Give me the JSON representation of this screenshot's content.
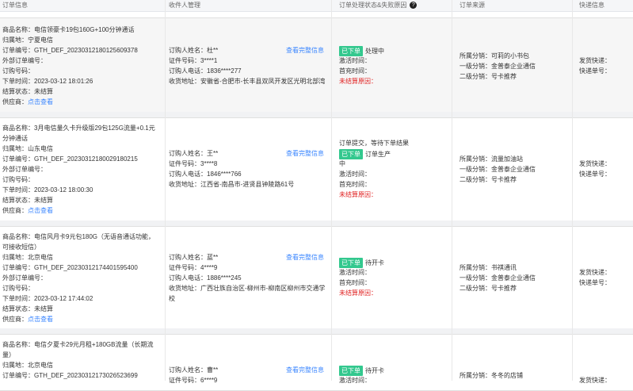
{
  "header": {
    "col_order": "订单信息",
    "col_receiver": "收件人管理",
    "col_status": "订单处理状态&失败原因",
    "col_source": "订单来源",
    "col_express": "快递信息"
  },
  "labels": {
    "product": "商品名称：",
    "region": "归属地：",
    "order_no": "订单编号：",
    "ext_no": "外部订单编号：",
    "order_code": "订购号码：",
    "order_time": "下单时间：",
    "settle": "结算状态：",
    "supplier": "供应商：",
    "view": "点击查看",
    "buyer": "订购人姓名：",
    "id_no": "证件号码：",
    "phone": "订购人电话：",
    "address": "收货地址：",
    "view_full": "查看完整信息",
    "activate": "激活时间：",
    "first_charge": "首充时间：",
    "not_settled_reason": "未结算原因：",
    "dist_owner": "所属分销：",
    "dist_l1": "一级分销：",
    "dist_l2": "二级分销：",
    "ship_express": "发货快递：",
    "express_no": "快递单号："
  },
  "orders": [
    {
      "product_1": "电信领豪卡19包160G+100分钟通话",
      "region": "宁夏电信",
      "order_no": "GTH_DEF_20230312180125609378",
      "time": "2023-03-12 18:01:26",
      "settle": "未结算",
      "buyer": "杜**",
      "id_no": "3****1",
      "phone": "1836****277",
      "address": "安徽省-合肥市-长丰县双凤开发区光明北部湾",
      "status_pre": "",
      "tag": "已下单",
      "status": "处理中",
      "dist_owner": "可莉的小书包",
      "dist_l1": "金普泰企业通信",
      "dist_l2": "号卡推荐"
    },
    {
      "product_1": "3月电信量久卡升级版29包125G流量+0.1元",
      "product_2": "分钟通话",
      "region": "山东电信",
      "order_no": "GTH_DEF_20230312180029180215",
      "time": "2023-03-12 18:00:30",
      "settle": "未结算",
      "buyer": "王**",
      "id_no": "3****8",
      "phone": "1846****766",
      "address": "江西省-南昌市-进贤县钟陵路61号",
      "status_pre": "订单提交，等待下单结果",
      "tag": "已下单",
      "status": "订单生产",
      "status_2": "中",
      "dist_owner": "流量加油站",
      "dist_l1": "金普泰企业通信",
      "dist_l2": "号卡推荐"
    },
    {
      "product_1": "电信风月卡9元包180G（无语音通话功能，",
      "product_2": "可接收短信）",
      "region": "北京电信",
      "order_no": "GTH_DEF_20230312174401595400",
      "time": "2023-03-12 17:44:02",
      "settle": "未结算",
      "buyer": "蓝**",
      "id_no": "4****9",
      "phone": "1886****245",
      "address": "广西壮族自治区-柳州市-柳南区柳州市交通学",
      "address_2": "校",
      "status_pre": "",
      "tag": "已下单",
      "status": "待开卡",
      "dist_owner": "书祺通讯",
      "dist_l1": "金普泰企业通信",
      "dist_l2": "号卡推荐"
    },
    {
      "product_1": "电信夕夏卡29元月租+180GB流量（长期流",
      "product_2": "量）",
      "region": "北京电信",
      "order_no": "GTH_DEF_20230312173026523699",
      "buyer": "曹**",
      "id_no": "6****9",
      "tag": "已下单",
      "status": "待开卡",
      "dist_owner": "冬冬的店铺"
    }
  ]
}
